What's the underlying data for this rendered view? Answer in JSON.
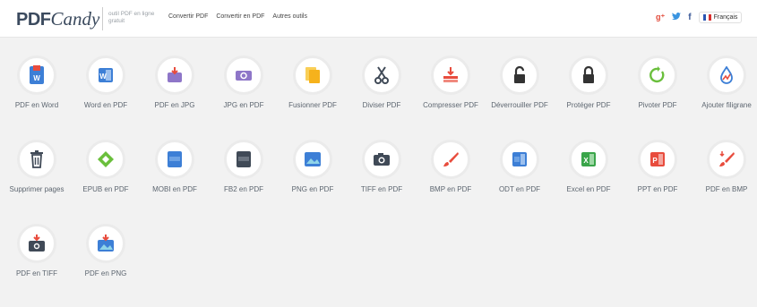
{
  "header": {
    "logo_main": "PDF",
    "logo_script": "Candy",
    "tagline": "outil PDF en ligne gratuit",
    "nav": [
      "Convertir PDF",
      "Convertir en PDF",
      "Autres outils"
    ],
    "language": "Français"
  },
  "social": {
    "google": "g⁺",
    "twitter": "🐦",
    "facebook": "f"
  },
  "colors": {
    "word_blue": "#3d7fd6",
    "pdf_red": "#e84c3d",
    "purple": "#8e76c8",
    "orange": "#f6b21c",
    "green": "#6abf3c",
    "dark": "#404a57"
  },
  "tools": [
    {
      "label": "PDF en Word",
      "icon": "pdf-to-word-icon"
    },
    {
      "label": "Word en PDF",
      "icon": "word-to-pdf-icon"
    },
    {
      "label": "PDF en JPG",
      "icon": "pdf-to-jpg-icon"
    },
    {
      "label": "JPG en PDF",
      "icon": "jpg-to-pdf-icon"
    },
    {
      "label": "Fusionner PDF",
      "icon": "merge-icon"
    },
    {
      "label": "Diviser PDF",
      "icon": "scissors-icon"
    },
    {
      "label": "Compresser PDF",
      "icon": "compress-icon"
    },
    {
      "label": "Déverrouiller PDF",
      "icon": "unlock-icon"
    },
    {
      "label": "Protéger PDF",
      "icon": "lock-icon"
    },
    {
      "label": "Pivoter PDF",
      "icon": "rotate-icon"
    },
    {
      "label": "Ajouter filigrane",
      "icon": "watermark-icon"
    },
    {
      "label": "Supprimer pages",
      "icon": "trash-icon"
    },
    {
      "label": "EPUB en PDF",
      "icon": "epub-icon"
    },
    {
      "label": "MOBI en PDF",
      "icon": "mobi-icon"
    },
    {
      "label": "FB2 en PDF",
      "icon": "fb2-icon"
    },
    {
      "label": "PNG en PDF",
      "icon": "png-icon"
    },
    {
      "label": "TIFF en PDF",
      "icon": "camera-icon"
    },
    {
      "label": "BMP en PDF",
      "icon": "brush-icon"
    },
    {
      "label": "ODT en PDF",
      "icon": "odt-icon"
    },
    {
      "label": "Excel en PDF",
      "icon": "excel-icon"
    },
    {
      "label": "PPT en PDF",
      "icon": "ppt-icon"
    },
    {
      "label": "PDF en BMP",
      "icon": "pdf-to-bmp-icon"
    },
    {
      "label": "PDF en TIFF",
      "icon": "pdf-to-tiff-icon"
    },
    {
      "label": "PDF en PNG",
      "icon": "pdf-to-png-icon"
    }
  ]
}
